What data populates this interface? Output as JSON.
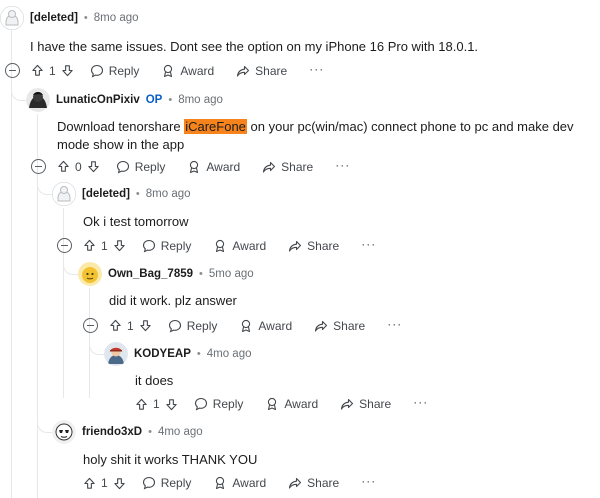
{
  "labels": {
    "reply": "Reply",
    "award": "Award",
    "share": "Share",
    "more": "···",
    "separator": "•"
  },
  "comments": [
    {
      "author": "[deleted]",
      "time": "8mo ago",
      "body": "I have the same issues. Dont see the option on my iPhone 16 Pro with 18.0.1.",
      "votes": "1",
      "avatar": "deleted"
    },
    {
      "author": "LunaticOnPixiv",
      "op": "OP",
      "time": "8mo ago",
      "body_before": "Download tenorshare ",
      "body_highlight": "iCareFone",
      "body_after": " on your pc(win/mac) connect phone to pc and make dev mode show in the app",
      "votes": "0",
      "avatar": "dark"
    },
    {
      "author": "[deleted]",
      "time": "8mo ago",
      "body": "Ok i test tomorrow",
      "votes": "1",
      "avatar": "deleted"
    },
    {
      "author": "Own_Bag_7859",
      "time": "5mo ago",
      "body": "did it work. plz answer",
      "votes": "1",
      "avatar": "yellow"
    },
    {
      "author": "KODYEAP",
      "time": "4mo ago",
      "body": "it does",
      "votes": "1",
      "avatar": "cap"
    },
    {
      "author": "friendo3xD",
      "time": "4mo ago",
      "body": "holy shit it works THANK YOU",
      "votes": "1",
      "avatar": "mask"
    }
  ]
}
